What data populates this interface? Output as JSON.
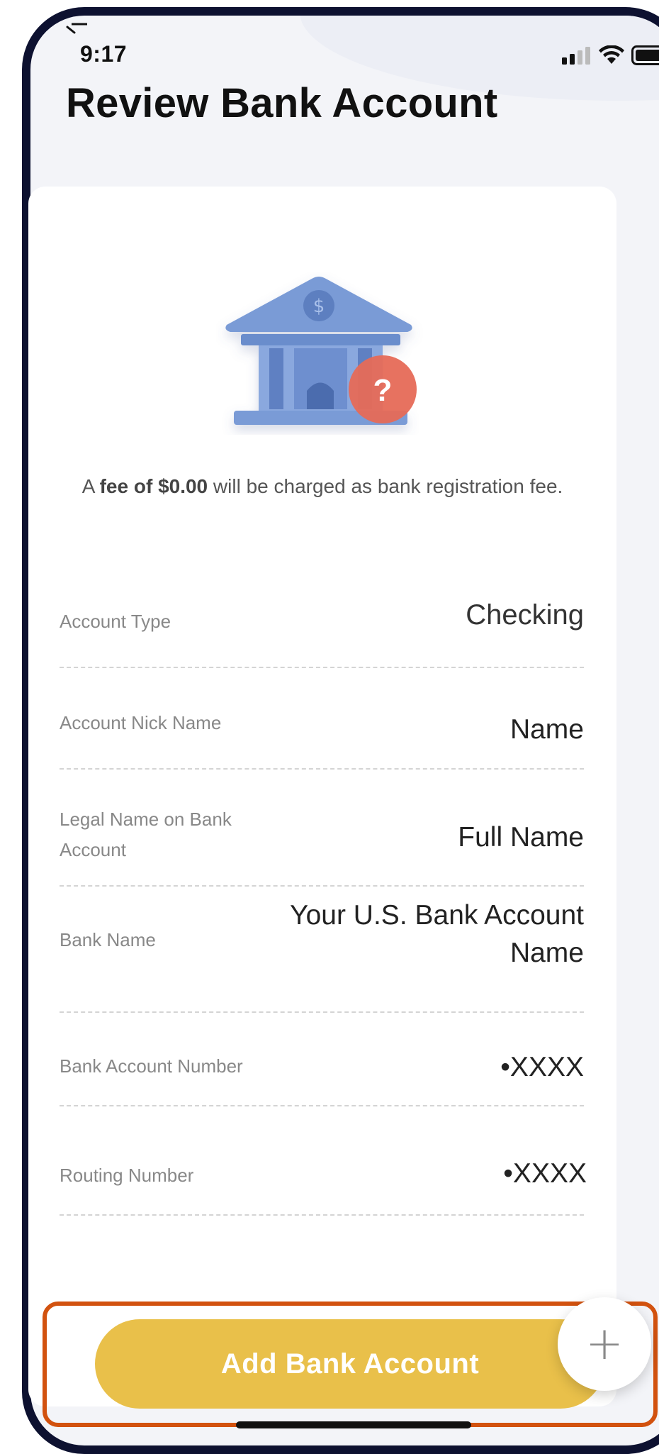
{
  "status_bar": {
    "time": "9:17"
  },
  "header": {
    "title": "Review Bank Account"
  },
  "fee_notice": {
    "prefix": "A ",
    "bold": "fee of $0.00",
    "suffix": " will be charged as bank registration fee."
  },
  "illustration": {
    "icon": "bank-icon",
    "badge_glyph": "?",
    "coin_glyph": "$"
  },
  "fields": [
    {
      "label": "Account Type",
      "value": "Checking"
    },
    {
      "label": "Account Nick Name",
      "value": "Name"
    },
    {
      "label": "Legal Name on Bank Account",
      "value": "Full Name"
    },
    {
      "label": "Bank Name",
      "value": "Your U.S. Bank Account Name"
    },
    {
      "label": "Bank Account Number",
      "value": "•XXXX"
    },
    {
      "label": "Routing Number",
      "value": "•XXXX"
    }
  ],
  "actions": {
    "primary_label": "Add Bank Account",
    "fab_glyph": "+"
  },
  "colors": {
    "accent": "#e9c04a",
    "highlight_border": "#d2520f",
    "bank_blue": "#7a9bd6",
    "badge_red": "#e66a57",
    "frame": "#0d1130"
  }
}
